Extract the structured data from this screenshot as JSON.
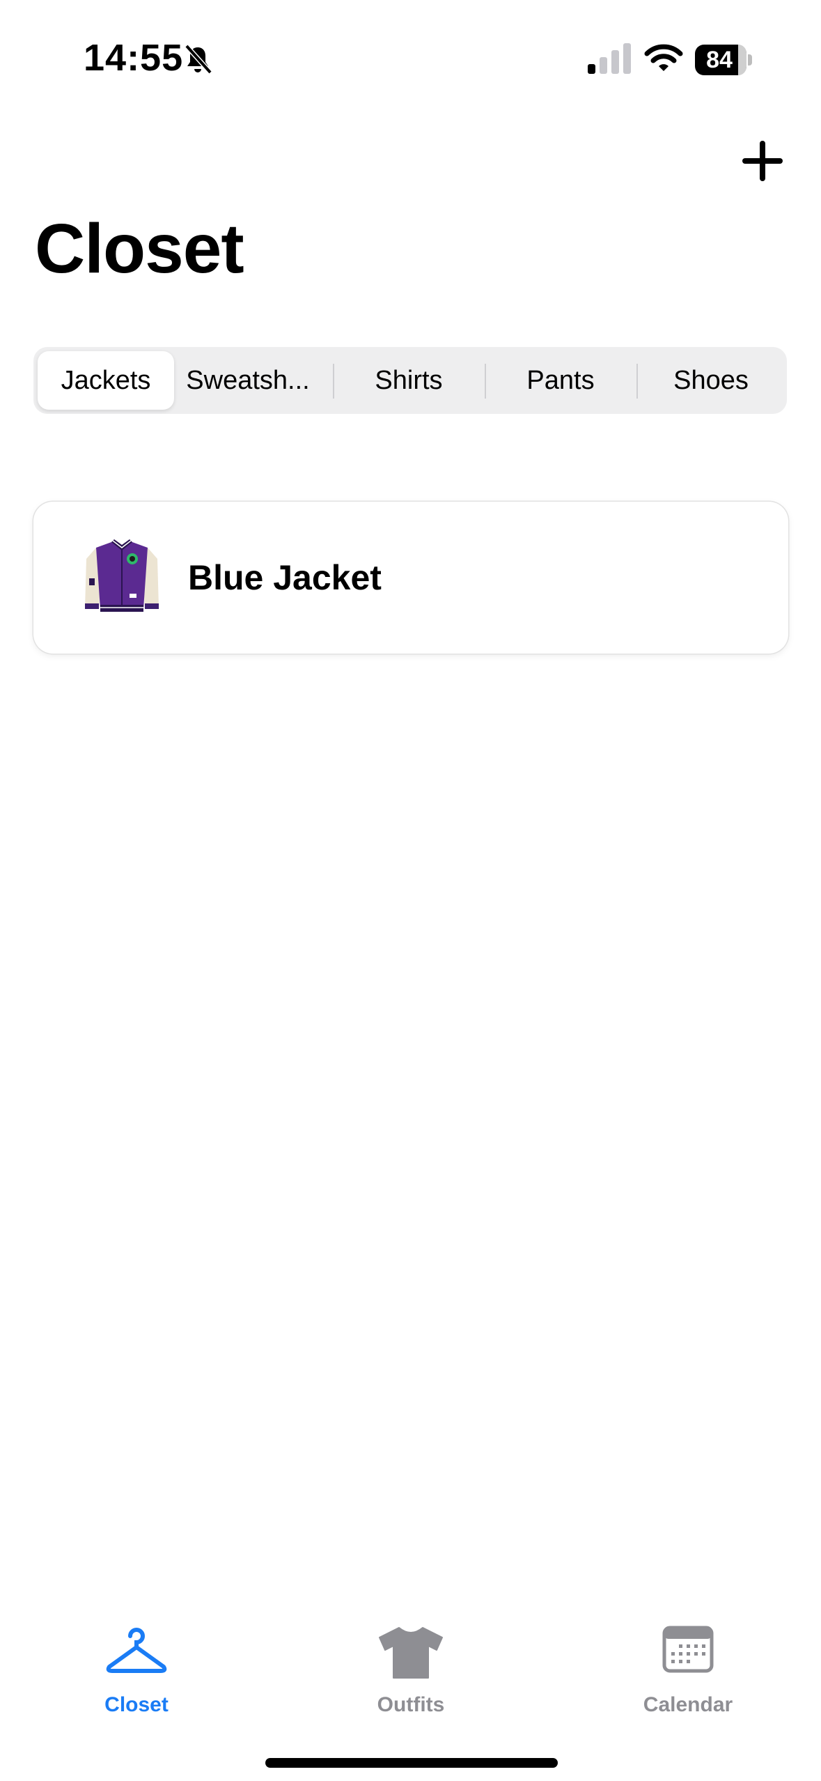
{
  "status_bar": {
    "time": "14:55",
    "battery": "84"
  },
  "header": {
    "title": "Closet"
  },
  "segments": [
    {
      "label": "Jackets",
      "selected": true
    },
    {
      "label": "Sweatsh...",
      "selected": false
    },
    {
      "label": "Shirts",
      "selected": false
    },
    {
      "label": "Pants",
      "selected": false
    },
    {
      "label": "Shoes",
      "selected": false
    }
  ],
  "items": [
    {
      "name": "Blue Jacket",
      "icon": "varsity-jacket-image"
    }
  ],
  "tab_bar": {
    "tabs": [
      {
        "label": "Closet",
        "icon": "hanger-icon",
        "active": true
      },
      {
        "label": "Outfits",
        "icon": "tshirt-icon",
        "active": false
      },
      {
        "label": "Calendar",
        "icon": "calendar-icon",
        "active": false
      }
    ]
  },
  "colors": {
    "accent": "#1a7cf5",
    "inactive": "#8e8e93"
  }
}
